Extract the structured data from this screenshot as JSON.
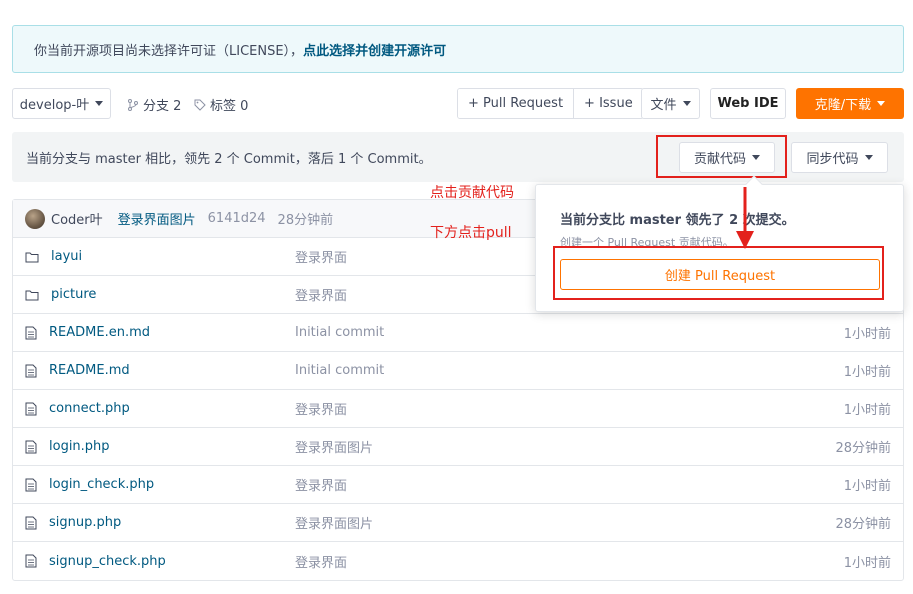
{
  "notice": {
    "text": "你当前开源项目尚未选择许可证（LICENSE），",
    "link": "点此选择并创建开源许可"
  },
  "toolbar": {
    "branch": "develop-叶",
    "branches": "分支 2",
    "tags": "标签 0",
    "pull_request": "+ Pull Request",
    "issue": "+ Issue",
    "files": "文件",
    "web_ide": "Web IDE",
    "clone": "克隆/下载"
  },
  "compare": {
    "text": "当前分支与 master 相比，领先 2 个 Commit，落后 1 个 Commit。",
    "contribute": "贡献代码",
    "sync": "同步代码"
  },
  "dropdown": {
    "title": "当前分支比 master 领先了 2 次提交。",
    "subtitle": "创建一个 Pull Request 贡献代码。",
    "create": "创建 Pull Request"
  },
  "annotations": {
    "click_contribute": "点击贡献代码",
    "click_pull": "下方点击pull"
  },
  "commit": {
    "author": "Coder叶",
    "message": "登录界面图片",
    "sha": "6141d24",
    "time": "28分钟前"
  },
  "files": [
    {
      "name": "layui",
      "type": "folder",
      "message": "登录界面",
      "time": ""
    },
    {
      "name": "picture",
      "type": "folder",
      "message": "登录界面",
      "time": ""
    },
    {
      "name": "README.en.md",
      "type": "file",
      "message": "Initial commit",
      "time": "1小时前"
    },
    {
      "name": "README.md",
      "type": "file",
      "message": "Initial commit",
      "time": "1小时前"
    },
    {
      "name": "connect.php",
      "type": "file",
      "message": "登录界面",
      "time": "1小时前"
    },
    {
      "name": "login.php",
      "type": "file",
      "message": "登录界面图片",
      "time": "28分钟前"
    },
    {
      "name": "login_check.php",
      "type": "file",
      "message": "登录界面",
      "time": "1小时前"
    },
    {
      "name": "signup.php",
      "type": "file",
      "message": "登录界面图片",
      "time": "28分钟前"
    },
    {
      "name": "signup_check.php",
      "type": "file",
      "message": "登录界面",
      "time": "1小时前"
    }
  ],
  "colors": {
    "accent": "#fe7300",
    "link": "#005980",
    "annotation": "#e3211c"
  }
}
